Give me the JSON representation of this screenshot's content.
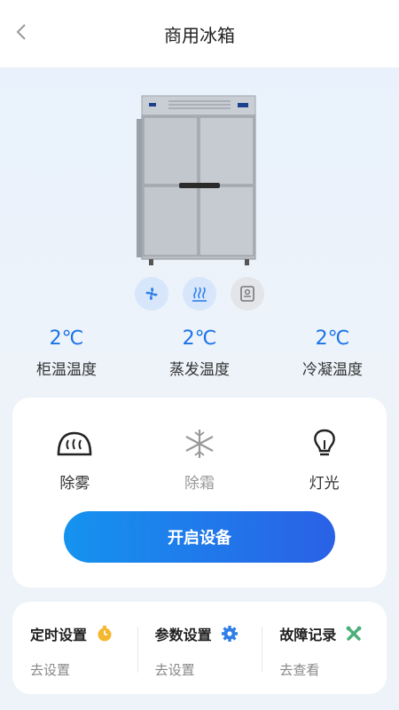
{
  "header": {
    "title": "商用冰箱"
  },
  "features": [
    {
      "name": "fan-icon"
    },
    {
      "name": "steam-icon"
    },
    {
      "name": "controller-icon"
    }
  ],
  "temps": [
    {
      "value": "2℃",
      "label": "柜温温度"
    },
    {
      "value": "2℃",
      "label": "蒸发温度"
    },
    {
      "value": "2℃",
      "label": "冷凝温度"
    }
  ],
  "controls": [
    {
      "label": "除雾",
      "enabled": true
    },
    {
      "label": "除霜",
      "enabled": false
    },
    {
      "label": "灯光",
      "enabled": true
    }
  ],
  "start_button": "开启设备",
  "tools": [
    {
      "title": "定时设置",
      "action": "去设置",
      "icon": "timer-icon",
      "color": "#f5b72e"
    },
    {
      "title": "参数设置",
      "action": "去设置",
      "icon": "gear-icon",
      "color": "#2f7fe8"
    },
    {
      "title": "故障记录",
      "action": "去查看",
      "icon": "wrench-icon",
      "color": "#4caf7a"
    }
  ],
  "colors": {
    "accent": "#1a73e8",
    "button_start": "#1593ef",
    "button_end": "#2a61e6"
  }
}
